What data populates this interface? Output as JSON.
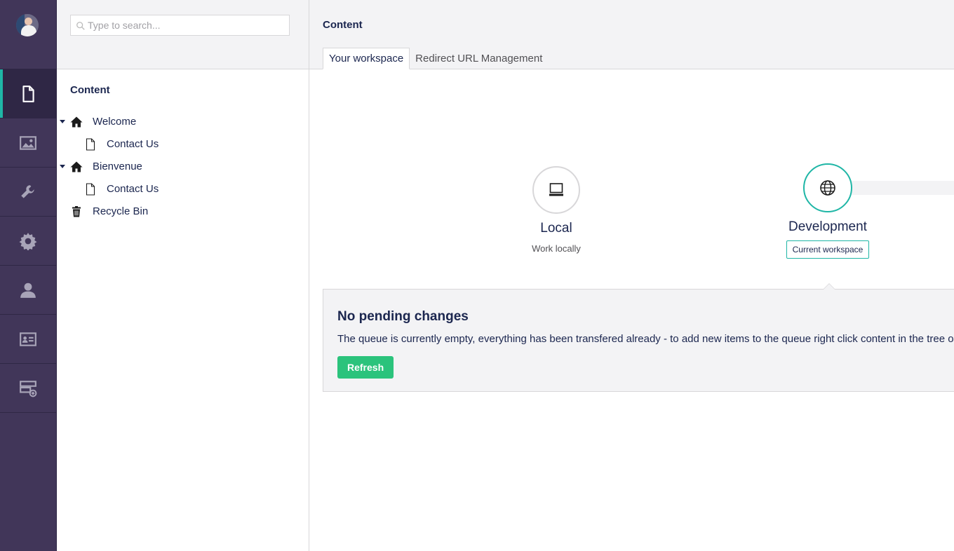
{
  "rail": {
    "items": [
      {
        "name": "content",
        "icon": "document-icon",
        "active": true
      },
      {
        "name": "media",
        "icon": "image-icon"
      },
      {
        "name": "settings",
        "icon": "wrench-icon"
      },
      {
        "name": "developer",
        "icon": "gear-icon"
      },
      {
        "name": "users",
        "icon": "user-icon"
      },
      {
        "name": "members",
        "icon": "id-card-icon"
      },
      {
        "name": "deploy",
        "icon": "server-add-icon"
      }
    ]
  },
  "search": {
    "placeholder": "Type to search..."
  },
  "tree": {
    "title": "Content",
    "nodes": [
      {
        "label": "Welcome",
        "icon": "home-icon",
        "expanded": true
      },
      {
        "label": "Contact Us",
        "icon": "document-icon"
      },
      {
        "label": "Bienvenue",
        "icon": "home-icon",
        "expanded": true
      },
      {
        "label": "Contact Us",
        "icon": "document-icon"
      },
      {
        "label": "Recycle Bin",
        "icon": "trash-icon"
      }
    ]
  },
  "main": {
    "title": "Content",
    "tabs": [
      {
        "label": "Your workspace",
        "active": true
      },
      {
        "label": "Redirect URL Management"
      }
    ],
    "workspaces": {
      "local": {
        "name": "Local",
        "subtitle": "Work locally",
        "icon": "laptop-icon"
      },
      "development": {
        "name": "Development",
        "badge": "Current workspace",
        "icon": "globe-icon"
      }
    },
    "panel": {
      "title": "No pending changes",
      "message": "The queue is currently empty, everything has been transfered already - to add new items to the queue right click content in the tree or",
      "button": "Refresh"
    }
  },
  "colors": {
    "rail": "#413659",
    "accent": "#1fb6a6",
    "success": "#2bc37c"
  }
}
